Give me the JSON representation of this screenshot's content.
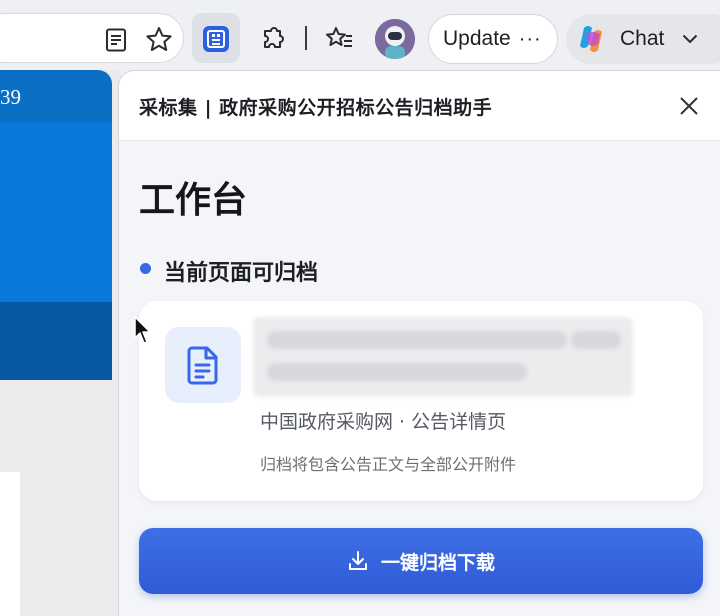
{
  "browser": {
    "update_label": "Update",
    "update_menu": "···",
    "chat_label": "Chat"
  },
  "background_page": {
    "number_fragment": "39"
  },
  "panel": {
    "title": "采标集 | 政府采购公开招标公告归档助手",
    "heading": "工作台",
    "status": "当前页面可归档",
    "card": {
      "source": "中国政府采购网 · 公告详情页",
      "note": "归档将包含公告正文与全部公开附件"
    },
    "archive_button_label": "一键归档下载"
  },
  "colors": {
    "accent": "#3867e8",
    "button": "#2f5bd6",
    "page_blue": "#0a78da"
  }
}
